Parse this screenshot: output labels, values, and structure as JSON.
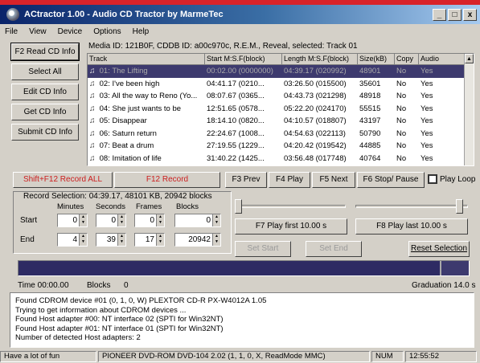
{
  "window": {
    "title": "ACtractor 1.00 - Audio CD Tractor by MarmeTec",
    "buttons": [
      "_",
      "□",
      "x"
    ]
  },
  "menu": [
    "File",
    "View",
    "Device",
    "Options",
    "Help"
  ],
  "left_buttons": [
    "F2 Read CD Info",
    "Select All",
    "Edit CD Info",
    "Get CD Info",
    "Submit CD Info"
  ],
  "info_line": "Media ID: 121B0F, CDDB ID: a00c970c, R.E.M., Reveal, selected: Track 01",
  "track_columns": [
    "Track",
    "Start M:S.F(block)",
    "Length M:S.F(block)",
    "Size(kB)",
    "Copy",
    "Audio"
  ],
  "tracks": [
    {
      "title": "01: The Lifting",
      "start": "00:02.00 (0000000)",
      "length": "04:39.17 (020992)",
      "size": "48901",
      "copy": "No",
      "audio": "Yes",
      "selected": true
    },
    {
      "title": "02: I've been high",
      "start": "04:41.17 (0210...",
      "length": "03:26.50 (015500)",
      "size": "35601",
      "copy": "No",
      "audio": "Yes",
      "selected": false
    },
    {
      "title": "03: All the way to Reno (Yo...",
      "start": "08:07.67 (0365...",
      "length": "04:43.73 (021298)",
      "size": "48918",
      "copy": "No",
      "audio": "Yes",
      "selected": false
    },
    {
      "title": "04: She just wants to be",
      "start": "12:51.65 (0578...",
      "length": "05:22.20 (024170)",
      "size": "55515",
      "copy": "No",
      "audio": "Yes",
      "selected": false
    },
    {
      "title": "05: Disappear",
      "start": "18:14.10 (0820...",
      "length": "04:10.57 (018807)",
      "size": "43197",
      "copy": "No",
      "audio": "Yes",
      "selected": false
    },
    {
      "title": "06: Saturn return",
      "start": "22:24.67 (1008...",
      "length": "04:54.63 (022113)",
      "size": "50790",
      "copy": "No",
      "audio": "Yes",
      "selected": false
    },
    {
      "title": "07: Beat a drum",
      "start": "27:19.55 (1229...",
      "length": "04:20.42 (019542)",
      "size": "44885",
      "copy": "No",
      "audio": "Yes",
      "selected": false
    },
    {
      "title": "08: Imitation of life",
      "start": "31:40.22 (1425...",
      "length": "03:56.48 (017748)",
      "size": "40764",
      "copy": "No",
      "audio": "Yes",
      "selected": false
    }
  ],
  "function_bar": {
    "record_all": "Shift+F12 Record ALL",
    "record": "F12 Record",
    "prev": "F3 Prev",
    "play": "F4 Play",
    "next": "F5 Next",
    "stop": "F6 Stop/ Pause",
    "play_loop": "Play Loop"
  },
  "record_selection": {
    "title": "Record Selection: 04:39.17, 48101 KB, 20942 blocks",
    "headers": [
      "Minutes",
      "Seconds",
      "Frames",
      "Blocks"
    ],
    "start_label": "Start",
    "end_label": "End",
    "start_values": [
      "0",
      "0",
      "0",
      "0"
    ],
    "end_values": [
      "4",
      "39",
      "17",
      "20942"
    ]
  },
  "play_controls": {
    "play_first": "F7 Play first 10.00 s",
    "play_last": "F8 Play last 10.00 s",
    "set_start": "Set Start",
    "set_end": "Set End",
    "reset_selection": "Reset Selection"
  },
  "timeline": {
    "time_label": "Time 00:00.00",
    "blocks_label": "Blocks",
    "blocks_value": "0",
    "graduation": "Graduation 14.0 s"
  },
  "progress_fraction": 0.94,
  "log_lines": [
    "Found CDROM device #01 (0, 1, 0, W) PLEXTOR CD-R   PX-W4012A 1.05",
    "Trying to get information about CDROM devices ...",
    "  Found Host adapter #00: NT interface 02 (SPTI for Win32NT)",
    "  Found Host adapter #01: NT interface 01 (SPTI for Win32NT)",
    "  Number of detected Host adapters: 2"
  ],
  "status_bar": {
    "left": "Have a lot of fun",
    "device": "PIONEER DVD-ROM DVD-104 2.02 (1, 1, 0, X, ReadMode MMC)",
    "num": "NUM",
    "clock": "12:55:52"
  }
}
